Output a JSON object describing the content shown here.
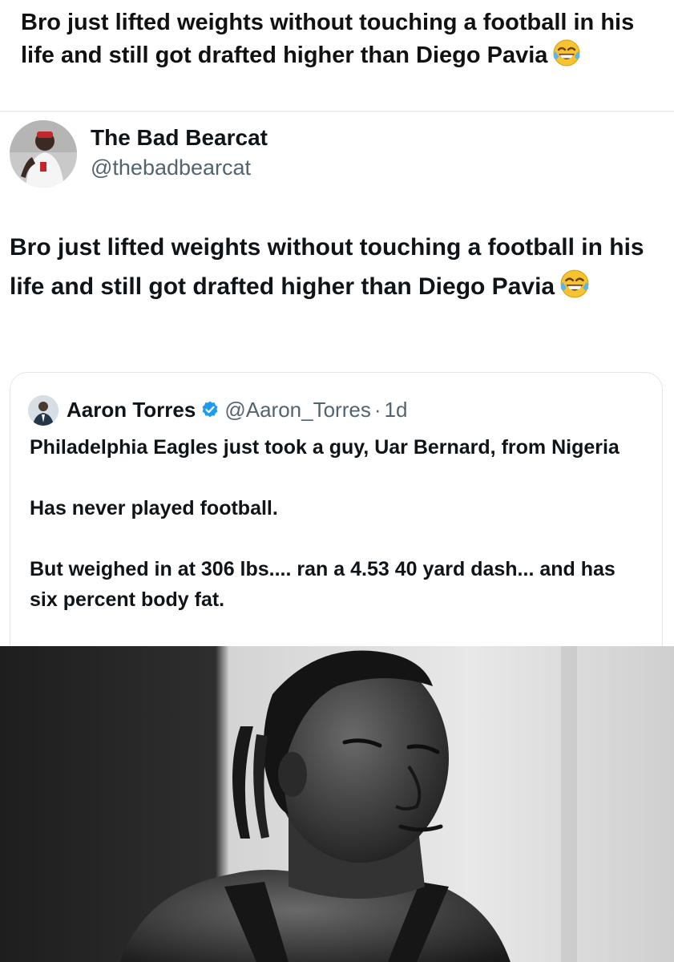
{
  "caption": {
    "text": "Bro just lifted weights without touching a football in his life and still got drafted higher than Diego Pavia",
    "emoji_icon": "tears-of-joy-emoji"
  },
  "tweet": {
    "author_name": "The Bad Bearcat",
    "author_handle": "@thebadbearcat",
    "text": "Bro just lifted weights without touching a football in his life and still got drafted higher than Diego Pavia",
    "emoji_icon": "tears-of-joy-emoji"
  },
  "quoted_tweet": {
    "author_name": "Aaron Torres",
    "verified_icon": "verified-badge-icon",
    "verified_color": "#1d9bf0",
    "handle": "@Aaron_Torres",
    "separator": "·",
    "time": "1d",
    "paragraphs": [
      "Philadelphia Eagles just took a guy, Uar Bernard, from Nigeria",
      "Has never played football.",
      "But weighed in at 306 lbs.... ran a 4.53 40 yard dash... and has six percent body fat."
    ]
  },
  "photo": {
    "icon": "athlete-photo"
  }
}
